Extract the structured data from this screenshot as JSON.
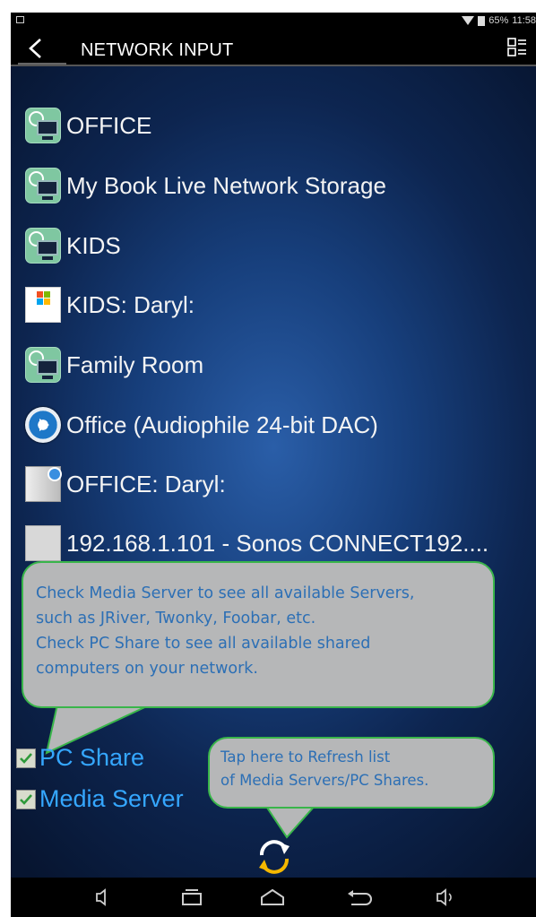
{
  "status_bar": {
    "battery": "65%",
    "time": "11:58"
  },
  "action_bar": {
    "title": "NETWORK INPUT"
  },
  "list": [
    {
      "label": "OFFICE",
      "icon": "network-computer-icon"
    },
    {
      "label": "My Book Live Network Storage",
      "icon": "network-computer-icon"
    },
    {
      "label": "KIDS",
      "icon": "network-computer-icon"
    },
    {
      "label": "KIDS: Daryl:",
      "icon": "windows-media-icon"
    },
    {
      "label": "Family Room",
      "icon": "network-computer-icon"
    },
    {
      "label": "Office (Audiophile 24-bit DAC)",
      "icon": "media-disc-icon"
    },
    {
      "label": "OFFICE: Daryl:",
      "icon": "media-server-tower-icon"
    },
    {
      "label": "192.168.1.101 - Sonos CONNECT192....",
      "icon": "generic-device-icon"
    }
  ],
  "callout_filters": {
    "lines": [
      "Check Media Server to see all available Servers,",
      "such as JRiver, Twonky, Foobar, etc.",
      "Check PC Share to see all available shared",
      "computers on your network."
    ]
  },
  "callout_refresh": {
    "lines": [
      "Tap here to Refresh list",
      "of Media Servers/PC Shares."
    ]
  },
  "filters": {
    "pc_share": {
      "label": "PC Share",
      "checked": true
    },
    "media_server": {
      "label": "Media Server",
      "checked": true
    }
  },
  "colors": {
    "accent": "#35a7ff",
    "callout_fill": "#b6b7b8",
    "callout_border": "#39b54a",
    "callout_text": "#2c6fb5",
    "refresh_icon": "#f5b800"
  }
}
